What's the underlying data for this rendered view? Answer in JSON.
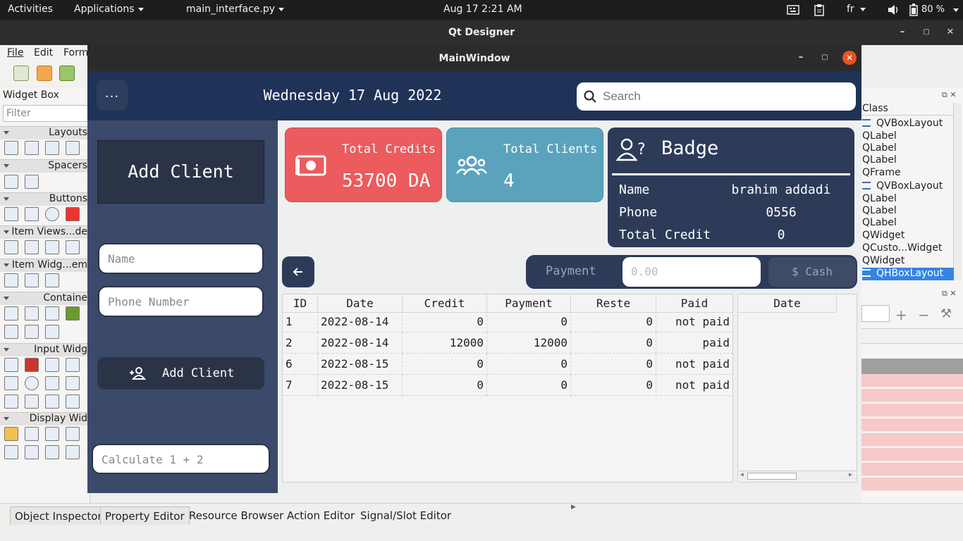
{
  "topbar": {
    "activities": "Activities",
    "applications": "Applications",
    "current_app": "main_interface.py",
    "clock": "Aug 17  2:21 AM",
    "lang": "fr",
    "battery": "80 %"
  },
  "designer": {
    "title": "Qt Designer",
    "menu": [
      "File",
      "Edit",
      "Form"
    ],
    "widget_box_title": "Widget Box",
    "filter_placeholder": "Filter",
    "categories": [
      "Layouts",
      "Spacers",
      "Buttons",
      "Item Views...de",
      "Item Widg...em",
      "Containe",
      "Input Widg",
      "Display Wid"
    ],
    "class_header": "Class",
    "classes": [
      "QVBoxLayout",
      "QLabel",
      "QLabel",
      "QLabel",
      "QFrame",
      "QVBoxLayout",
      "QLabel",
      "QLabel",
      "QLabel",
      "QWidget",
      "QCusto...Widget",
      "QWidget",
      "QHBoxLayout"
    ],
    "bottom_tabs": [
      "Object Inspector",
      "Property Editor",
      "Resource Browser",
      "Action Editor",
      "Signal/Slot Editor"
    ]
  },
  "mainwindow": {
    "title": "MainWindow",
    "menu_button": "...",
    "date": "Wednesday 17 Aug 2022",
    "search_placeholder": "Search",
    "sidebar": {
      "title": "Add Client",
      "name_placeholder": "Name",
      "phone_placeholder": "Phone Number",
      "add_button": "Add Client",
      "calc_placeholder": "Calculate 1 + 2"
    },
    "cards": {
      "credits_title": "Total Credits",
      "credits_value": "53700 DA",
      "clients_title": "Total Clients",
      "clients_value": "4"
    },
    "badge": {
      "title": "Badge",
      "name_label": "Name",
      "name_value": "brahim addadi",
      "phone_label": "Phone",
      "phone_value": "0556",
      "credit_label": "Total Credit",
      "credit_value": "0"
    },
    "payment": {
      "label": "Payment",
      "placeholder": "0.00",
      "cash_button": "$ Cash"
    },
    "table": {
      "columns": [
        "ID",
        "Date",
        "Credit",
        "Payment",
        "Reste",
        "Paid"
      ],
      "rows": [
        [
          "1",
          "2022-08-14",
          "0",
          "0",
          "0",
          "not paid"
        ],
        [
          "2",
          "2022-08-14",
          "12000",
          "12000",
          "0",
          "paid"
        ],
        [
          "6",
          "2022-08-15",
          "0",
          "0",
          "0",
          "not paid"
        ],
        [
          "7",
          "2022-08-15",
          "0",
          "0",
          "0",
          "not paid"
        ]
      ]
    },
    "side_table": {
      "column": "Date"
    }
  },
  "colors": {
    "header": "#1f3358",
    "sidebar": "#3b4a6b",
    "credits_card": "#ec5b5d",
    "clients_card": "#5ba3bd",
    "badge": "#2d3b59"
  }
}
